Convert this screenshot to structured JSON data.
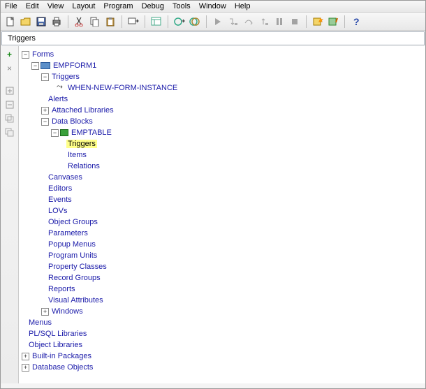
{
  "menubar": [
    "File",
    "Edit",
    "View",
    "Layout",
    "Program",
    "Debug",
    "Tools",
    "Window",
    "Help"
  ],
  "pathbar": {
    "value": "Triggers"
  },
  "gutter": {
    "add": "+",
    "del": "×"
  },
  "tree": {
    "root": "Forms",
    "form": "EMPFORM1",
    "form_children": {
      "triggers": "Triggers",
      "trigger_item": "WHEN-NEW-FORM-INSTANCE",
      "alerts": "Alerts",
      "attached_libs": "Attached Libraries",
      "data_blocks": "Data Blocks",
      "emptable": "EMPTABLE",
      "emptable_children": {
        "triggers": "Triggers",
        "items": "Items",
        "relations": "Relations"
      },
      "canvases": "Canvases",
      "editors": "Editors",
      "events": "Events",
      "lovs": "LOVs",
      "object_groups": "Object Groups",
      "parameters": "Parameters",
      "popup_menus": "Popup Menus",
      "program_units": "Program Units",
      "property_classes": "Property Classes",
      "record_groups": "Record Groups",
      "reports": "Reports",
      "visual_attributes": "Visual Attributes",
      "windows": "Windows"
    },
    "menus": "Menus",
    "plsql_libs": "PL/SQL Libraries",
    "object_libs": "Object Libraries",
    "builtin_pkgs": "Built-in Packages",
    "db_objects": "Database Objects"
  }
}
